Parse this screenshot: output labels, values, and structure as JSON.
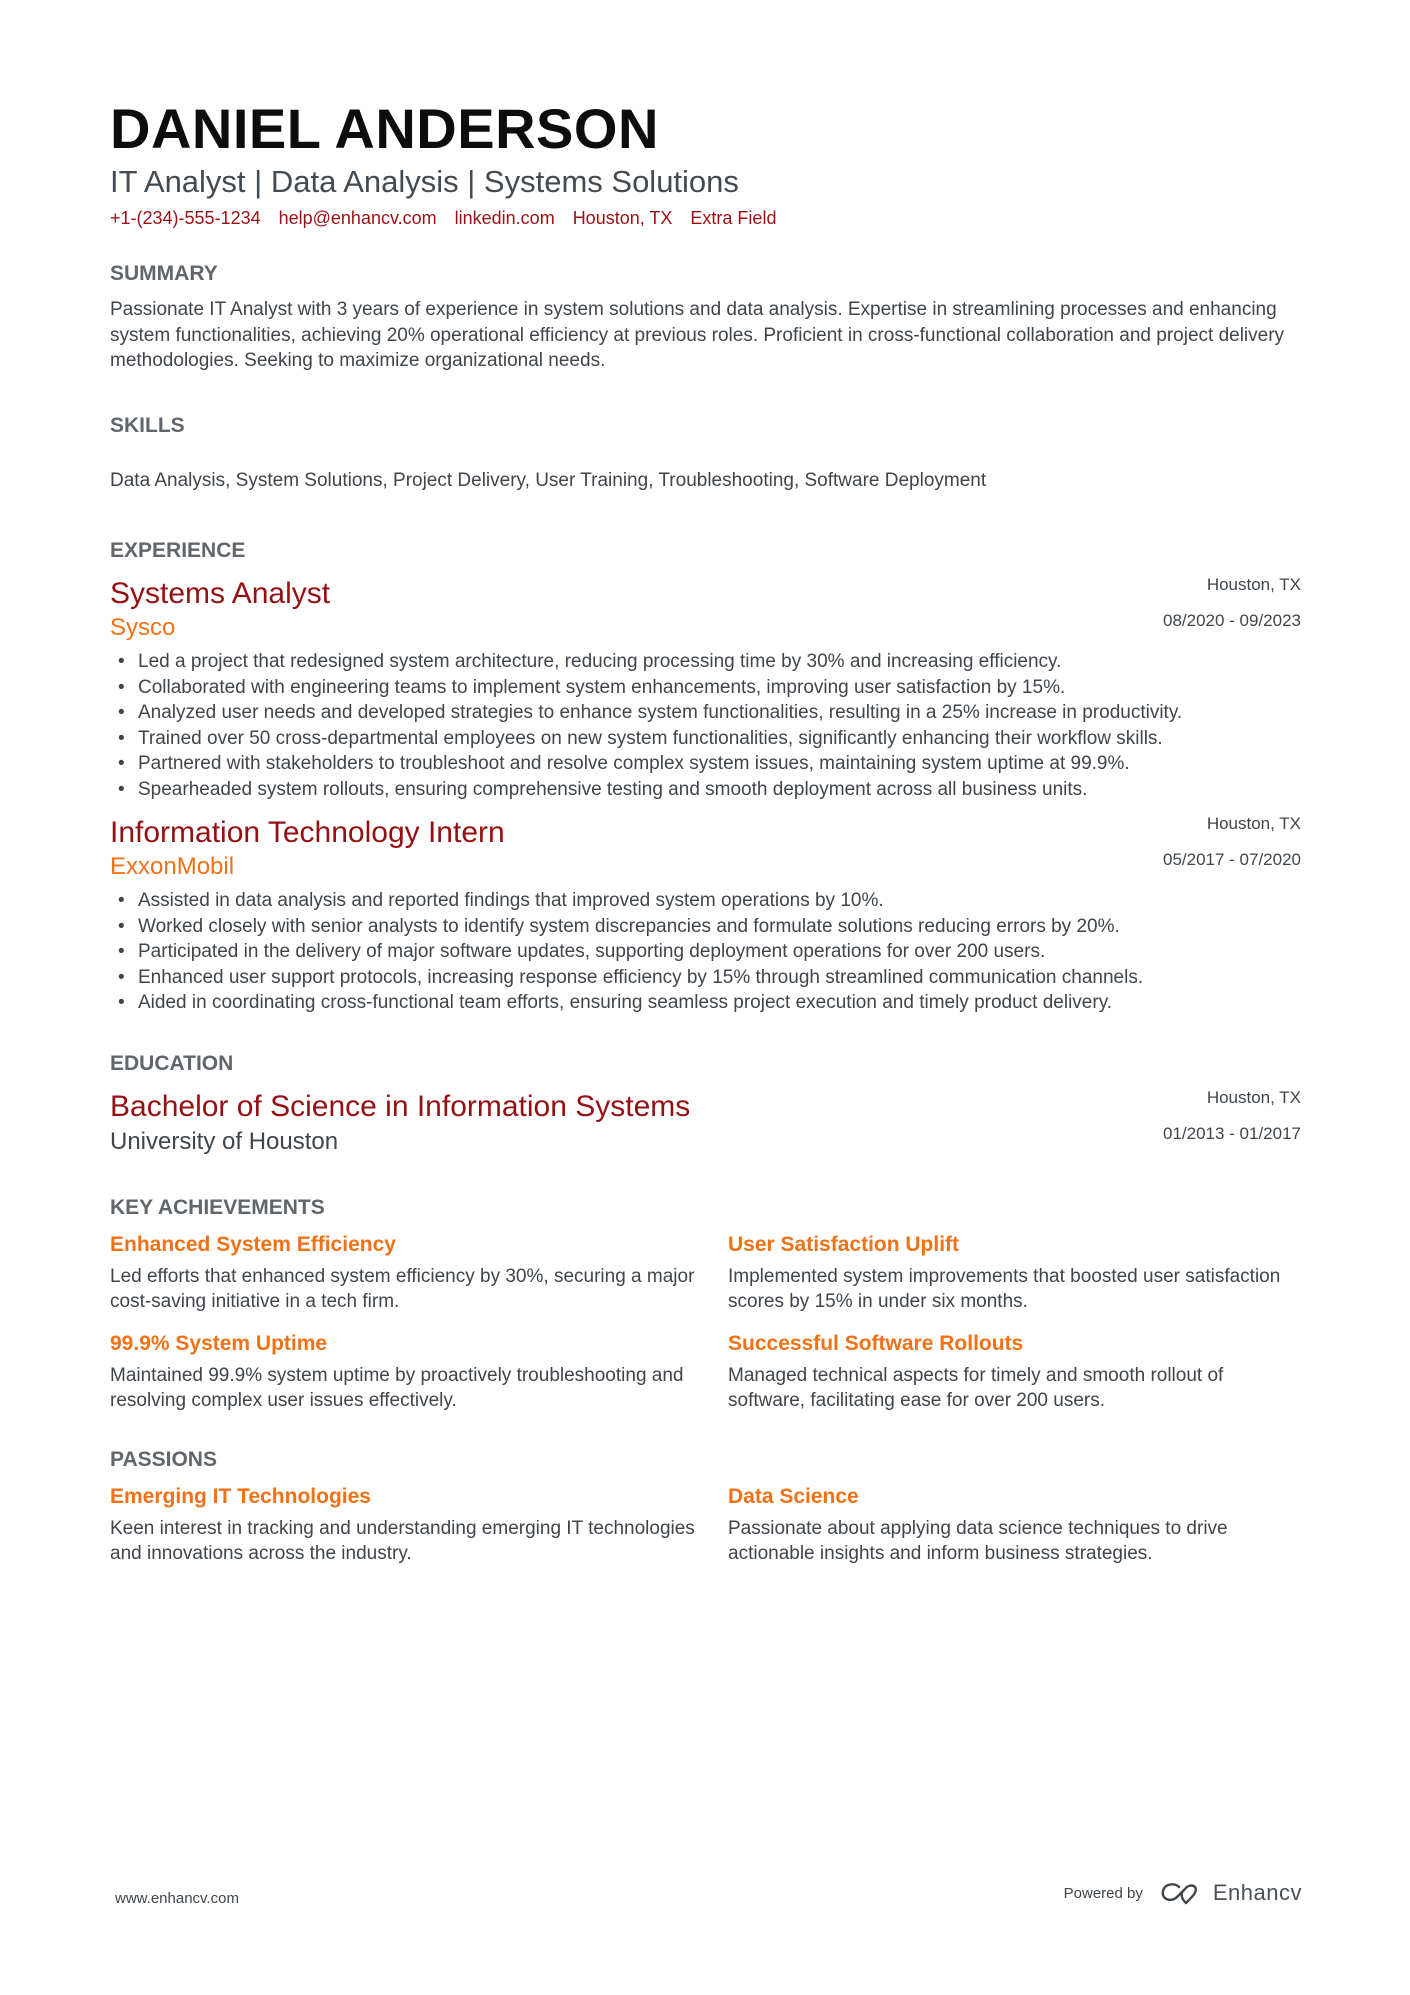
{
  "header": {
    "name": "DANIEL ANDERSON",
    "subtitle": "IT Analyst | Data Analysis | Systems Solutions",
    "contacts": [
      "+1-(234)-555-1234",
      "help@enhancv.com",
      "linkedin.com",
      "Houston, TX",
      "Extra Field"
    ]
  },
  "summary": {
    "title": "SUMMARY",
    "text": "Passionate IT Analyst with 3 years of experience in system solutions and data analysis. Expertise in streamlining processes and enhancing system functionalities, achieving 20% operational efficiency at previous roles. Proficient in cross-functional collaboration and project delivery methodologies. Seeking to maximize organizational needs."
  },
  "skills": {
    "title": "SKILLS",
    "text": "Data Analysis, System Solutions, Project Delivery, User Training, Troubleshooting, Software Deployment"
  },
  "experience": {
    "title": "EXPERIENCE",
    "jobs": [
      {
        "title": "Systems Analyst",
        "company": "Sysco",
        "location": "Houston, TX",
        "dates": "08/2020 - 09/2023",
        "bullets": [
          "Led a project that redesigned system architecture, reducing processing time by 30% and increasing efficiency.",
          "Collaborated with engineering teams to implement system enhancements, improving user satisfaction by 15%.",
          "Analyzed user needs and developed strategies to enhance system functionalities, resulting in a 25% increase in productivity.",
          "Trained over 50 cross-departmental employees on new system functionalities, significantly enhancing their workflow skills.",
          "Partnered with stakeholders to troubleshoot and resolve complex system issues, maintaining system uptime at 99.9%.",
          "Spearheaded system rollouts, ensuring comprehensive testing and smooth deployment across all business units."
        ]
      },
      {
        "title": "Information Technology Intern",
        "company": "ExxonMobil",
        "location": "Houston, TX",
        "dates": "05/2017 - 07/2020",
        "bullets": [
          "Assisted in data analysis and reported findings that improved system operations by 10%.",
          "Worked closely with senior analysts to identify system discrepancies and formulate solutions reducing errors by 20%.",
          "Participated in the delivery of major software updates, supporting deployment operations for over 200 users.",
          "Enhanced user support protocols, increasing response efficiency by 15% through streamlined communication channels.",
          "Aided in coordinating cross-functional team efforts, ensuring seamless project execution and timely product delivery."
        ]
      }
    ]
  },
  "education": {
    "title": "EDUCATION",
    "degree": "Bachelor of Science in Information Systems",
    "school": "University of Houston",
    "location": "Houston, TX",
    "dates": "01/2013 - 01/2017"
  },
  "achievements": {
    "title": "KEY ACHIEVEMENTS",
    "items": [
      {
        "title": "Enhanced System Efficiency",
        "text": "Led efforts that enhanced system efficiency by 30%, securing a major cost-saving initiative in a tech firm."
      },
      {
        "title": "User Satisfaction Uplift",
        "text": "Implemented system improvements that boosted user satisfaction scores by 15% in under six months."
      },
      {
        "title": "99.9% System Uptime",
        "text": "Maintained 99.9% system uptime by proactively troubleshooting and resolving complex user issues effectively."
      },
      {
        "title": "Successful Software Rollouts",
        "text": "Managed technical aspects for timely and smooth rollout of software, facilitating ease for over 200 users."
      }
    ]
  },
  "passions": {
    "title": "PASSIONS",
    "items": [
      {
        "title": "Emerging IT Technologies",
        "text": "Keen interest in tracking and understanding emerging IT technologies and innovations across the industry."
      },
      {
        "title": "Data Science",
        "text": "Passionate about applying data science techniques to drive actionable insights and inform business strategies."
      }
    ]
  },
  "footer": {
    "website": "www.enhancv.com",
    "powered_by": "Powered by",
    "brand": "Enhancv"
  },
  "colors": {
    "accent_dark_red": "#951012",
    "accent_orange": "#f07116",
    "section_gray": "#60666b"
  }
}
